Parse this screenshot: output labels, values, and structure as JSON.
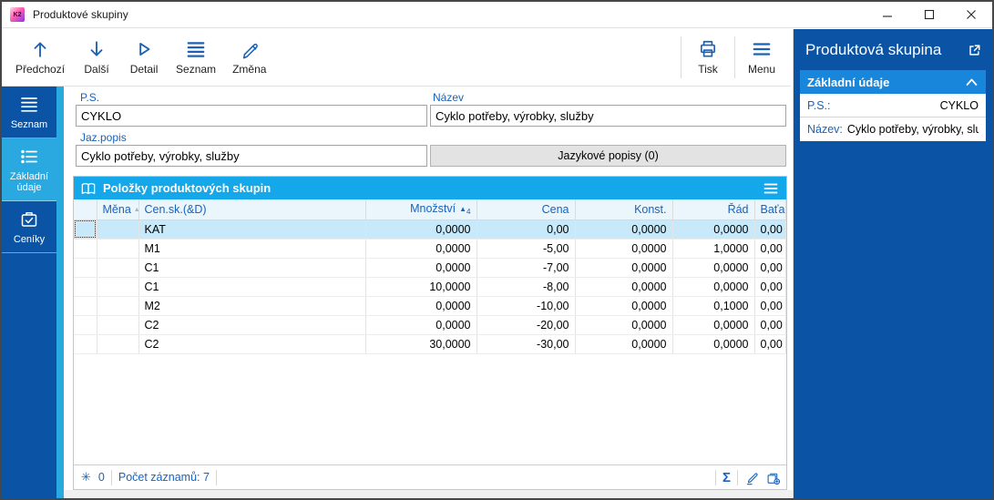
{
  "window": {
    "title": "Produktové skupiny",
    "icon_text": "K2"
  },
  "toolbar": {
    "buttons_left": [
      {
        "label": "Předchozí",
        "icon": "arrow-up-icon"
      },
      {
        "label": "Další",
        "icon": "arrow-down-icon"
      },
      {
        "label": "Detail",
        "icon": "play-outline-icon"
      },
      {
        "label": "Seznam",
        "icon": "list-icon"
      },
      {
        "label": "Změna",
        "icon": "pencil-icon"
      }
    ],
    "buttons_right": [
      {
        "label": "Tisk",
        "icon": "printer-icon"
      },
      {
        "label": "Menu",
        "icon": "menu-icon"
      }
    ]
  },
  "sidebar": {
    "items": [
      {
        "label": "Seznam",
        "icon": "list-4-lines-icon",
        "selected": false
      },
      {
        "label": "Základní údaje",
        "icon": "list-detail-icon",
        "selected": true
      },
      {
        "label": "Ceníky",
        "icon": "case-check-icon",
        "selected": false
      }
    ]
  },
  "form": {
    "ps_label": "P.S.",
    "ps_value": "CYKLO",
    "nazev_label": "Název",
    "nazev_value": "Cyklo potřeby, výrobky, služby",
    "jazpopis_label": "Jaz.popis",
    "jazpopis_value": "Cyklo potřeby, výrobky, služby",
    "lang_button_label": "Jazykové popisy (0)"
  },
  "table": {
    "title": "Položky produktových skupin",
    "columns": [
      "Měna",
      "Cen.sk.(&D)",
      "Množství",
      "Cena",
      "Konst.",
      "Řád",
      "Baťa"
    ],
    "sort_column": "Množství",
    "sort_direction": "asc",
    "sort_order": "4",
    "rows": [
      {
        "selected": true,
        "mena": "",
        "censk": "KAT",
        "mnozstvi": "0,0000",
        "cena": "0,00",
        "konst": "0,0000",
        "rad": "0,0000",
        "bata": "0,00"
      },
      {
        "selected": false,
        "mena": "",
        "censk": "M1",
        "mnozstvi": "0,0000",
        "cena": "-5,00",
        "konst": "0,0000",
        "rad": "1,0000",
        "bata": "0,00"
      },
      {
        "selected": false,
        "mena": "",
        "censk": "C1",
        "mnozstvi": "0,0000",
        "cena": "-7,00",
        "konst": "0,0000",
        "rad": "0,0000",
        "bata": "0,00"
      },
      {
        "selected": false,
        "mena": "",
        "censk": "C1",
        "mnozstvi": "10,0000",
        "cena": "-8,00",
        "konst": "0,0000",
        "rad": "0,0000",
        "bata": "0,00"
      },
      {
        "selected": false,
        "mena": "",
        "censk": "M2",
        "mnozstvi": "0,0000",
        "cena": "-10,00",
        "konst": "0,0000",
        "rad": "0,1000",
        "bata": "0,00"
      },
      {
        "selected": false,
        "mena": "",
        "censk": "C2",
        "mnozstvi": "0,0000",
        "cena": "-20,00",
        "konst": "0,0000",
        "rad": "0,0000",
        "bata": "0,00"
      },
      {
        "selected": false,
        "mena": "",
        "censk": "C2",
        "mnozstvi": "30,0000",
        "cena": "-30,00",
        "konst": "0,0000",
        "rad": "0,0000",
        "bata": "0,00"
      }
    ],
    "status": {
      "flag_count": "0",
      "records_label": "Počet záznamů: 7"
    }
  },
  "right_panel": {
    "title": "Produktová skupina",
    "section_title": "Základní údaje",
    "rows": [
      {
        "label": "P.S.:",
        "value": "CYKLO"
      },
      {
        "label": "Název:",
        "value": "Cyklo potřeby, výrobky, slu..."
      }
    ]
  },
  "colors": {
    "dark_blue": "#0B54A5",
    "accent_blue": "#2AA8E0",
    "cyan_header": "#14A7E9",
    "section_blue": "#1886DB",
    "label_blue": "#1763BE"
  }
}
